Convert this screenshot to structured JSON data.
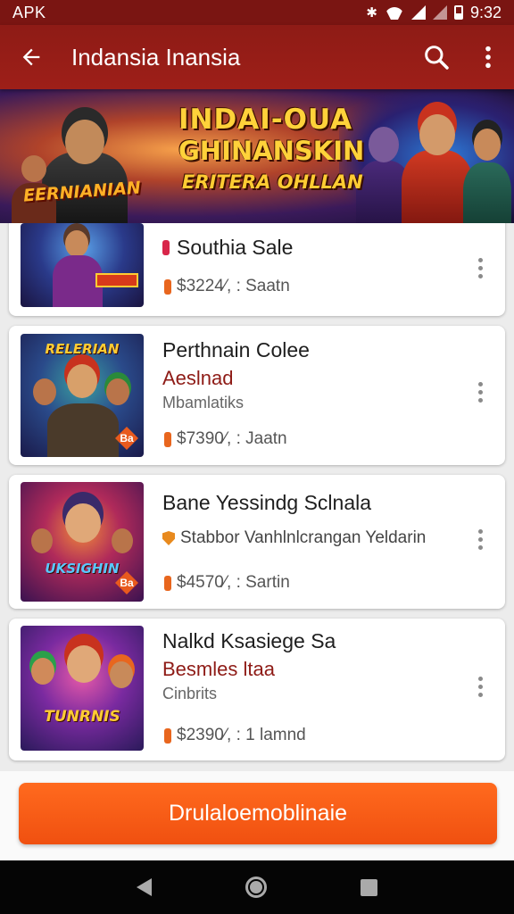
{
  "status_bar": {
    "carrier": "APK",
    "time": "9:32"
  },
  "app_bar": {
    "title": "Indansia Inansia"
  },
  "banner": {
    "line1": "INDAI-OUA",
    "line2": "GHINANSKIN",
    "line3": "ERITERA OHLLAN",
    "badge": "EERNIANIAN"
  },
  "items": [
    {
      "title": "Southia Sale",
      "subtitle": "",
      "meta": "",
      "price": "$3224⁄, : Saatn",
      "price_icon": "pip",
      "title_icon": "pip-red",
      "thumb_label": "",
      "badge": ""
    },
    {
      "title": "Perthnain Colee",
      "subtitle": "Aeslnad",
      "meta": "Mbamlatiks",
      "price": "$7390⁄, : Jaatn",
      "price_icon": "pip",
      "thumb_label": "RELERIAN",
      "badge": "Ba"
    },
    {
      "title": "Bane Yessindg Sclnala",
      "subtitle": "Stabbor Vanhlnlcrangan Yeldarin",
      "meta": "",
      "price": "$4570⁄, : Sartin",
      "price_icon": "pip",
      "thumb_label": "UKSIGHIN",
      "badge": "Ba"
    },
    {
      "title": "Nalkd Ksasiege Sa",
      "subtitle": "Besmles ltaa",
      "meta": "Cinbrits",
      "price": "$2390⁄, : 1 lamnd",
      "price_icon": "pip",
      "thumb_label": "TUNRNIS",
      "badge": ""
    }
  ],
  "cta": {
    "label": "Drulaloemoblinaie"
  },
  "colors": {
    "primary": "#9e1f18",
    "accent": "#f05a14"
  }
}
